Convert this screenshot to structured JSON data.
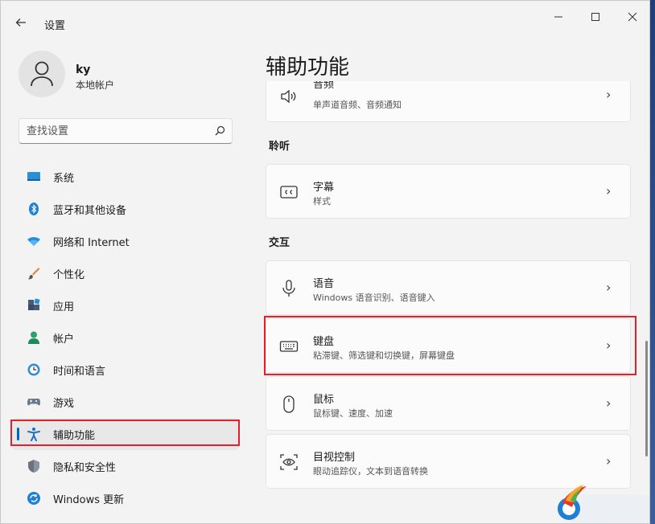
{
  "window": {
    "title": "设置",
    "back_icon": "back-arrow-icon",
    "controls": {
      "minimize": "minimize-icon",
      "maximize": "maximize-icon",
      "close": "close-icon"
    }
  },
  "profile": {
    "name": "ky",
    "account_type": "本地帐户",
    "icon": "person-icon"
  },
  "search": {
    "placeholder": "查找设置",
    "icon": "search-icon"
  },
  "nav": {
    "items": [
      {
        "label": "系统",
        "icon": "monitor-icon",
        "selected": false
      },
      {
        "label": "蓝牙和其他设备",
        "icon": "bluetooth-icon",
        "selected": false
      },
      {
        "label": "网络和 Internet",
        "icon": "wifi-icon",
        "selected": false
      },
      {
        "label": "个性化",
        "icon": "brush-icon",
        "selected": false
      },
      {
        "label": "应用",
        "icon": "apps-icon",
        "selected": false
      },
      {
        "label": "帐户",
        "icon": "account-icon",
        "selected": false
      },
      {
        "label": "时间和语言",
        "icon": "clock-globe-icon",
        "selected": false
      },
      {
        "label": "游戏",
        "icon": "gamepad-icon",
        "selected": false
      },
      {
        "label": "辅助功能",
        "icon": "accessibility-icon",
        "selected": true
      },
      {
        "label": "隐私和安全性",
        "icon": "shield-icon",
        "selected": false
      },
      {
        "label": "Windows 更新",
        "icon": "update-icon",
        "selected": false
      }
    ]
  },
  "main": {
    "title": "辅助功能",
    "audio_card": {
      "title": "音频",
      "subtitle": "单声道音频、音频通知",
      "icon": "speaker-icon"
    },
    "sections": {
      "hearing": "聆听",
      "interaction": "交互"
    },
    "cards": {
      "captions": {
        "title": "字幕",
        "subtitle": "样式",
        "icon": "captions-icon"
      },
      "speech": {
        "title": "语音",
        "subtitle": "Windows 语音识别、语音键入",
        "icon": "microphone-icon"
      },
      "keyboard": {
        "title": "键盘",
        "subtitle": "粘滞键、筛选键和切换键，屏幕键盘",
        "icon": "keyboard-icon"
      },
      "mouse": {
        "title": "鼠标",
        "subtitle": "鼠标键、速度、加速",
        "icon": "mouse-icon"
      },
      "eye_control": {
        "title": "目视控制",
        "subtitle": "眼动追踪仪，文本到语音转换",
        "icon": "eye-control-icon"
      }
    },
    "chevron": "›"
  },
  "colors": {
    "accent": "#0067c0",
    "highlight": "#e0202a",
    "background": "#f3f3f3",
    "card": "#fbfbfb"
  }
}
